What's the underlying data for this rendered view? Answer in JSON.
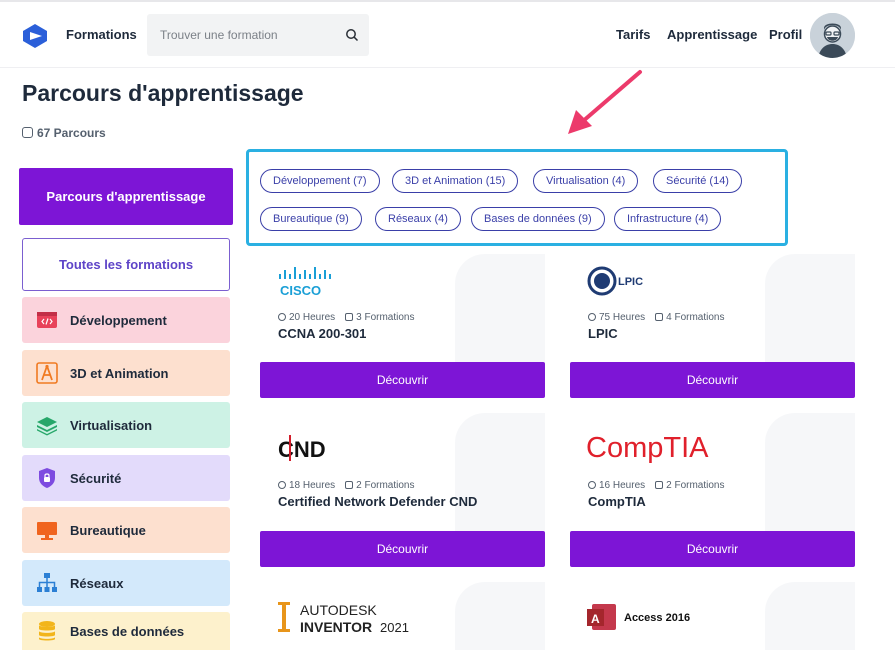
{
  "header": {
    "brand": "Formations",
    "search_placeholder": "Trouver une formation",
    "nav": [
      "Tarifs",
      "Apprentissage",
      "Profil"
    ]
  },
  "page": {
    "title": "Parcours d'apprentissage",
    "count": "67 Parcours"
  },
  "sidebar": {
    "active": "Parcours d'apprentissage",
    "all": "Toutes les formations",
    "categories": [
      {
        "label": "Développement",
        "color": "#fbd3dc",
        "icon": "code-window-icon"
      },
      {
        "label": "3D et Animation",
        "color": "#fde0cf",
        "icon": "compass-icon"
      },
      {
        "label": "Virtualisation",
        "color": "#cdf2e5",
        "icon": "layers-icon"
      },
      {
        "label": "Sécurité",
        "color": "#e3dbfb",
        "icon": "shield-lock-icon"
      },
      {
        "label": "Bureautique",
        "color": "#fde0cf",
        "icon": "monitor-icon"
      },
      {
        "label": "Réseaux",
        "color": "#d3e9fb",
        "icon": "network-icon"
      },
      {
        "label": "Bases de données",
        "color": "#fdf1cc",
        "icon": "database-icon"
      }
    ]
  },
  "filters": [
    "Développement (7)",
    "3D et Animation (15)",
    "Virtualisation (4)",
    "Sécurité (14)",
    "Bureautique (9)",
    "Réseaux (4)",
    "Bases de données (9)",
    "Infrastructure (4)"
  ],
  "cards": [
    {
      "logo": "CISCO",
      "hours": "20 Heures",
      "formations": "3 Formations",
      "title": "CCNA 200-301",
      "button": "Découvrir"
    },
    {
      "logo": "LPIC",
      "hours": "75 Heures",
      "formations": "4 Formations",
      "title": "LPIC",
      "button": "Découvrir"
    },
    {
      "logo": "CND",
      "hours": "18 Heures",
      "formations": "2 Formations",
      "title": "Certified Network Defender CND",
      "button": "Découvrir"
    },
    {
      "logo": "CompTIA",
      "hours": "16 Heures",
      "formations": "2 Formations",
      "title": "CompTIA",
      "button": "Découvrir"
    },
    {
      "logo_line1": "AUTODESK",
      "logo_line2": "INVENTOR",
      "logo_year": "2021"
    },
    {
      "logo": "Access 2016"
    }
  ],
  "colors": {
    "primary": "#7d15d6",
    "highlight": "#2ab0e2",
    "arrow": "#ec3a6b"
  }
}
